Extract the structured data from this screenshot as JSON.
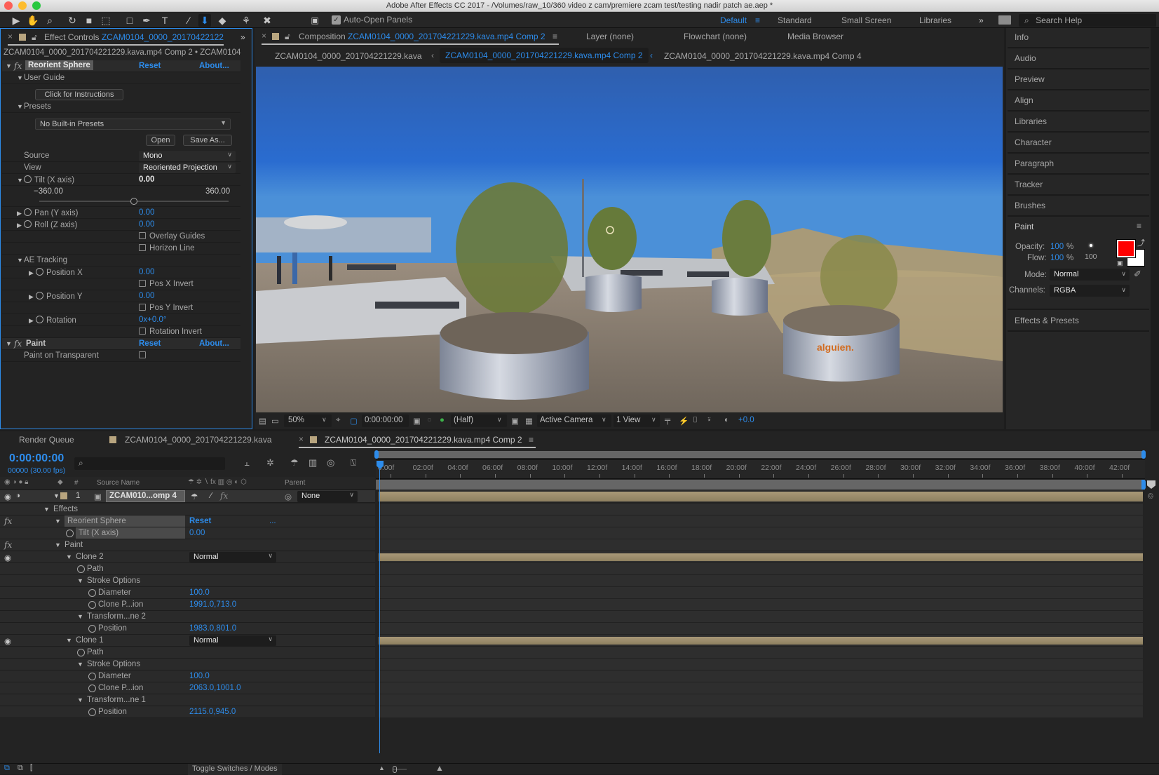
{
  "window": {
    "title": "Adobe After Effects CC 2017 - /Volumes/raw_10/360 video z cam/premiere zcam test/testing nadir patch ae.aep *"
  },
  "toolbar": {
    "tools": [
      "selection-tool",
      "hand-tool",
      "zoom-tool",
      "rotation-tool",
      "camera-tool",
      "pan-behind-tool",
      "rectangle-tool",
      "pen-tool",
      "type-tool",
      "brush-tool",
      "clone-stamp-tool",
      "eraser-tool",
      "roto-brush-tool",
      "puppet-pin-tool"
    ],
    "active_tool": "clone-stamp-tool",
    "auto_open_panels_label": "Auto-Open Panels",
    "auto_open_panels_checked": true,
    "workspaces": [
      "Default",
      "Standard",
      "Small Screen",
      "Libraries"
    ],
    "active_workspace": "Default",
    "overflow": "»",
    "search_placeholder": "Search Help"
  },
  "effect_controls": {
    "tab_prefix": "Effect Controls",
    "tab_layer": "ZCAM0104_0000_20170422122",
    "breadcrumb": "ZCAM0104_0000_201704221229.kava.mp4 Comp 2 • ZCAM0104",
    "reorient_sphere": {
      "name": "Reorient Sphere",
      "reset": "Reset",
      "about": "About...",
      "user_guide": "User Guide",
      "instructions_button": "Click for Instructions",
      "presets": "Presets",
      "presets_value": "No Built-in Presets",
      "open_button": "Open",
      "save_as_button": "Save As...",
      "source_label": "Source",
      "source_value": "Mono",
      "view_label": "View",
      "view_value": "Reoriented Projection",
      "tilt_label": "Tilt (X axis)",
      "tilt_value": "0.00",
      "tilt_min": "−360.00",
      "tilt_max": "360.00",
      "tilt_slider_fraction": 0.5,
      "pan_label": "Pan (Y axis)",
      "pan_value": "0.00",
      "roll_label": "Roll (Z axis)",
      "roll_value": "0.00",
      "overlay_guides": "Overlay Guides",
      "horizon_line": "Horizon Line",
      "ae_tracking": "AE Tracking",
      "position_x_label": "Position X",
      "position_x_value": "0.00",
      "pos_x_invert": "Pos X Invert",
      "position_y_label": "Position Y",
      "position_y_value": "0.00",
      "pos_y_invert": "Pos Y Invert",
      "rotation_label": "Rotation",
      "rotation_value": "0x+0.0°",
      "rotation_invert": "Rotation Invert"
    },
    "paint": {
      "name": "Paint",
      "reset": "Reset",
      "about": "About...",
      "paint_on_transparent": "Paint on Transparent"
    }
  },
  "composition": {
    "tab_prefix": "Composition",
    "tab_comp": "ZCAM0104_0000_201704221229.kava.mp4 Comp 2",
    "other_tabs": [
      "Layer (none)",
      "Flowchart (none)",
      "Media Browser"
    ],
    "nav": [
      "ZCAM0104_0000_201704221229.kava",
      "ZCAM0104_0000_201704221229.kava.mp4 Comp 2",
      "ZCAM0104_0000_201704221229.kava.mp4 Comp 4"
    ],
    "viewer_bar": {
      "zoom": "50%",
      "timecode": "0:00:00:00",
      "resolution": "(Half)",
      "camera": "Active Camera",
      "views": "1 View",
      "exposure": "+0.0"
    },
    "image_overlay_text": "alguien."
  },
  "right_panel": {
    "items": [
      "Info",
      "Audio",
      "Preview",
      "Align",
      "Libraries",
      "Character",
      "Paragraph",
      "Tracker",
      "Brushes"
    ],
    "paint": {
      "title": "Paint",
      "opacity_label": "Opacity:",
      "opacity_value": "100",
      "flow_label": "Flow:",
      "flow_value": "100",
      "percent": "%",
      "brush_size": "100",
      "mode_label": "Mode:",
      "mode_value": "Normal",
      "channels_label": "Channels:",
      "channels_value": "RGBA",
      "foreground_color": "#ff0000",
      "background_color": "#ffffff"
    },
    "effects_presets": "Effects & Presets"
  },
  "timeline": {
    "tabs": [
      "Render Queue",
      "ZCAM0104_0000_201704221229.kava",
      "ZCAM0104_0000_201704221229.kava.mp4 Comp 2"
    ],
    "timecode": "0:00:00:00",
    "frame_info": "00000 (30.00 fps)",
    "columns": {
      "number": "#",
      "source_name": "Source Name",
      "parent": "Parent"
    },
    "layer": {
      "number": "1",
      "name": "ZCAM010...omp 4",
      "parent": "None"
    },
    "rows": [
      {
        "label": "Effects",
        "indent": 1,
        "twirl": true
      },
      {
        "label": "Reorient Sphere",
        "indent": 2,
        "twirl": true,
        "fx": true,
        "value": "Reset",
        "extra": "...",
        "highlight": true
      },
      {
        "label": "Tilt (X axis)",
        "indent": 3,
        "stopwatch": true,
        "value": "0.00",
        "highlight": true
      },
      {
        "label": "Paint",
        "indent": 2,
        "twirl": true,
        "fx": true
      },
      {
        "label": "Clone 2",
        "indent": 3,
        "twirl": true,
        "eye": true,
        "mode": "Normal",
        "bar": true
      },
      {
        "label": "Path",
        "indent": 4,
        "stopwatch": true
      },
      {
        "label": "Stroke Options",
        "indent": 4,
        "twirl": true
      },
      {
        "label": "Diameter",
        "indent": 5,
        "stopwatch": true,
        "value": "100.0"
      },
      {
        "label": "Clone P...ion",
        "indent": 5,
        "stopwatch": true,
        "value": "1991.0,713.0"
      },
      {
        "label": "Transform...ne 2",
        "indent": 4,
        "twirl": true
      },
      {
        "label": "Position",
        "indent": 5,
        "stopwatch": true,
        "value": "1983.0,801.0"
      },
      {
        "label": "Clone 1",
        "indent": 3,
        "twirl": true,
        "eye": true,
        "mode": "Normal",
        "bar": true
      },
      {
        "label": "Path",
        "indent": 4,
        "stopwatch": true
      },
      {
        "label": "Stroke Options",
        "indent": 4,
        "twirl": true
      },
      {
        "label": "Diameter",
        "indent": 5,
        "stopwatch": true,
        "value": "100.0"
      },
      {
        "label": "Clone P...ion",
        "indent": 5,
        "stopwatch": true,
        "value": "2063.0,1001.0"
      },
      {
        "label": "Transform...ne 1",
        "indent": 4,
        "twirl": true
      },
      {
        "label": "Position",
        "indent": 5,
        "stopwatch": true,
        "value": "2115.0,945.0"
      }
    ],
    "ruler": [
      "0:00f",
      "02:00f",
      "04:00f",
      "06:00f",
      "08:00f",
      "10:00f",
      "12:00f",
      "14:00f",
      "16:00f",
      "18:00f",
      "20:00f",
      "22:00f",
      "24:00f",
      "26:00f",
      "28:00f",
      "30:00f",
      "32:00f",
      "34:00f",
      "36:00f",
      "38:00f",
      "40:00f",
      "42:00f"
    ],
    "toggle_label": "Toggle Switches / Modes"
  },
  "colors": {
    "accent": "#2d8ceb",
    "layer_bar": "#a89877",
    "label_swatch": "#b8a57f",
    "panel_bg": "#232323"
  }
}
